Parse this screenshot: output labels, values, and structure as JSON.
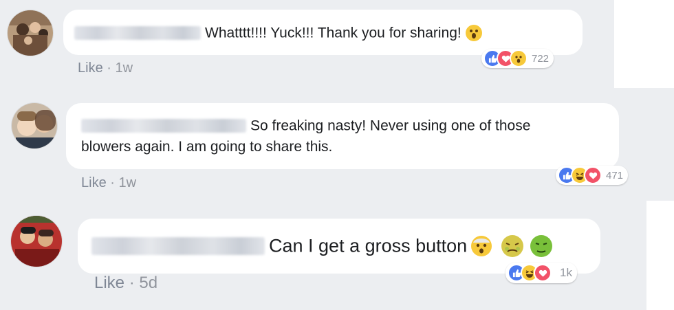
{
  "comments": [
    {
      "text": "Whatttt!!!! Yuck!!! Thank you for sharing!",
      "reaction_count": "722",
      "reactions": [
        "like",
        "love",
        "wow"
      ],
      "like_label": "Like",
      "separator": "·",
      "time": "1w"
    },
    {
      "text_line1": "So freaking nasty! Never using one of those",
      "text_line2": "blowers again. I am going to share this.",
      "reaction_count": "471",
      "reactions": [
        "like",
        "haha",
        "love"
      ],
      "like_label": "Like",
      "separator": "·",
      "time": "1w"
    },
    {
      "text": "Can I get a gross button",
      "reaction_count": "1k",
      "reactions": [
        "like",
        "haha",
        "love"
      ],
      "inline_emojis": [
        "shocked-face",
        "nauseated-face",
        "sick-green-face"
      ],
      "like_label": "Like",
      "separator": "·",
      "time": "5d"
    }
  ],
  "colors": {
    "like": "#4a79ef",
    "love": "#f25268",
    "haha": "#f7c93a",
    "meta_text": "#90949c",
    "bubble": "#ffffff",
    "background": "#eceef1"
  }
}
